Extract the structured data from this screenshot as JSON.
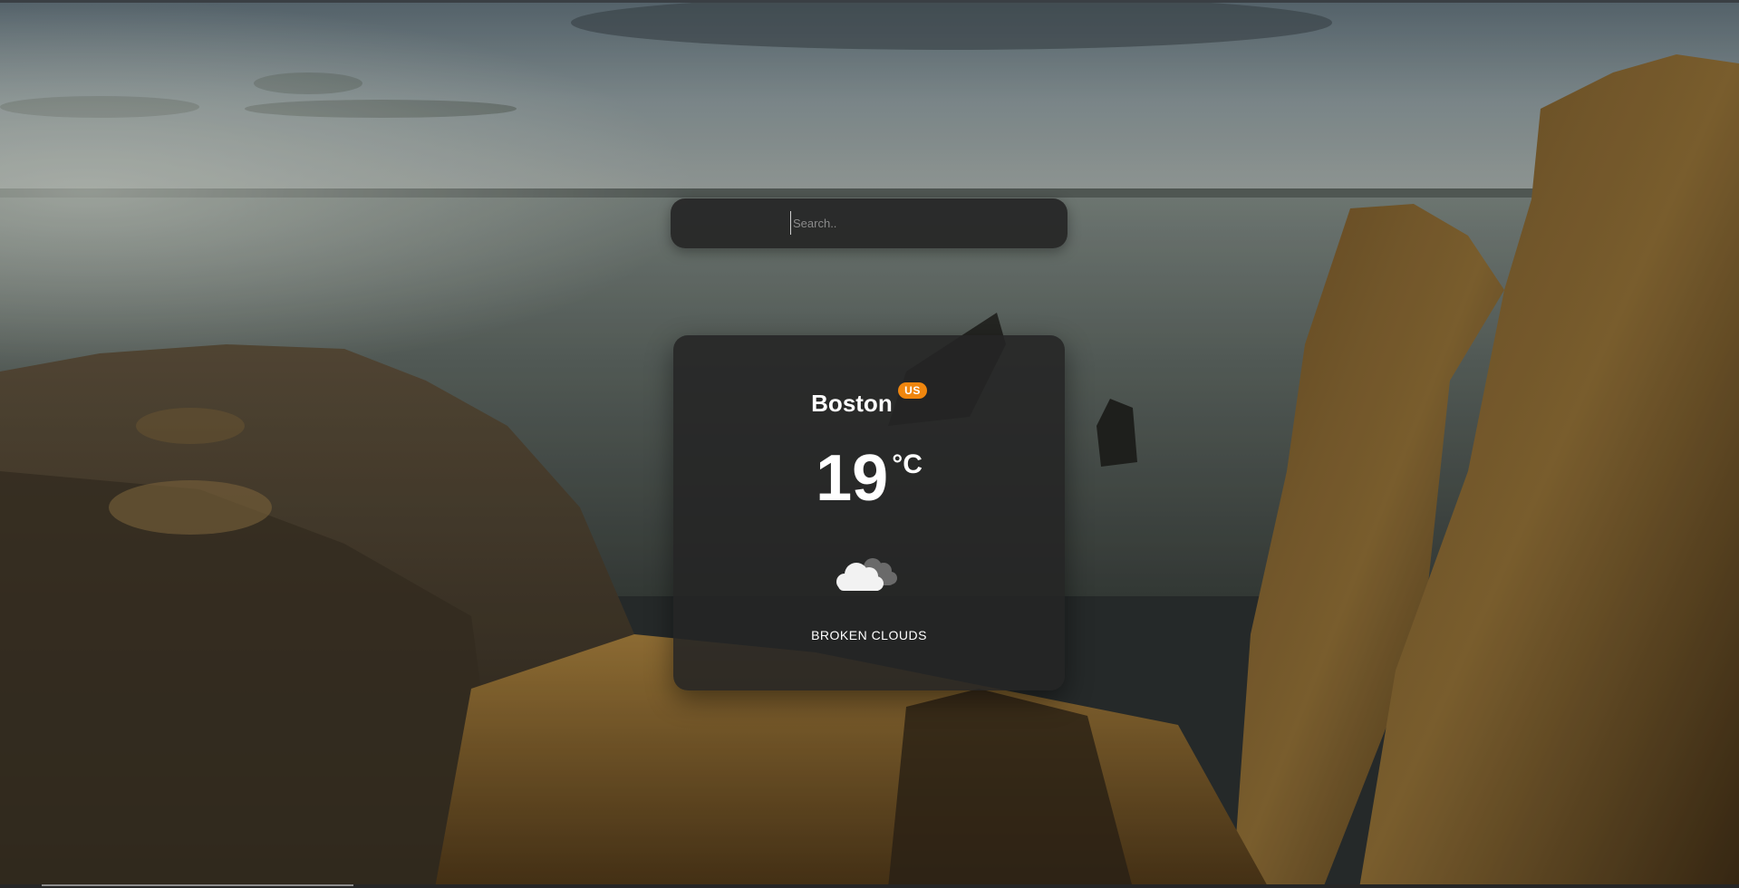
{
  "search": {
    "placeholder": "Search..",
    "value": ""
  },
  "weather": {
    "city": "Boston",
    "country": "US",
    "temperature": "19",
    "unit": "°C",
    "description": "BROKEN CLOUDS",
    "icon": "broken-clouds-icon"
  },
  "colors": {
    "badge": "#f0860e",
    "card_bg": "#242424",
    "search_bg": "#262626",
    "text": "#ffffff"
  }
}
